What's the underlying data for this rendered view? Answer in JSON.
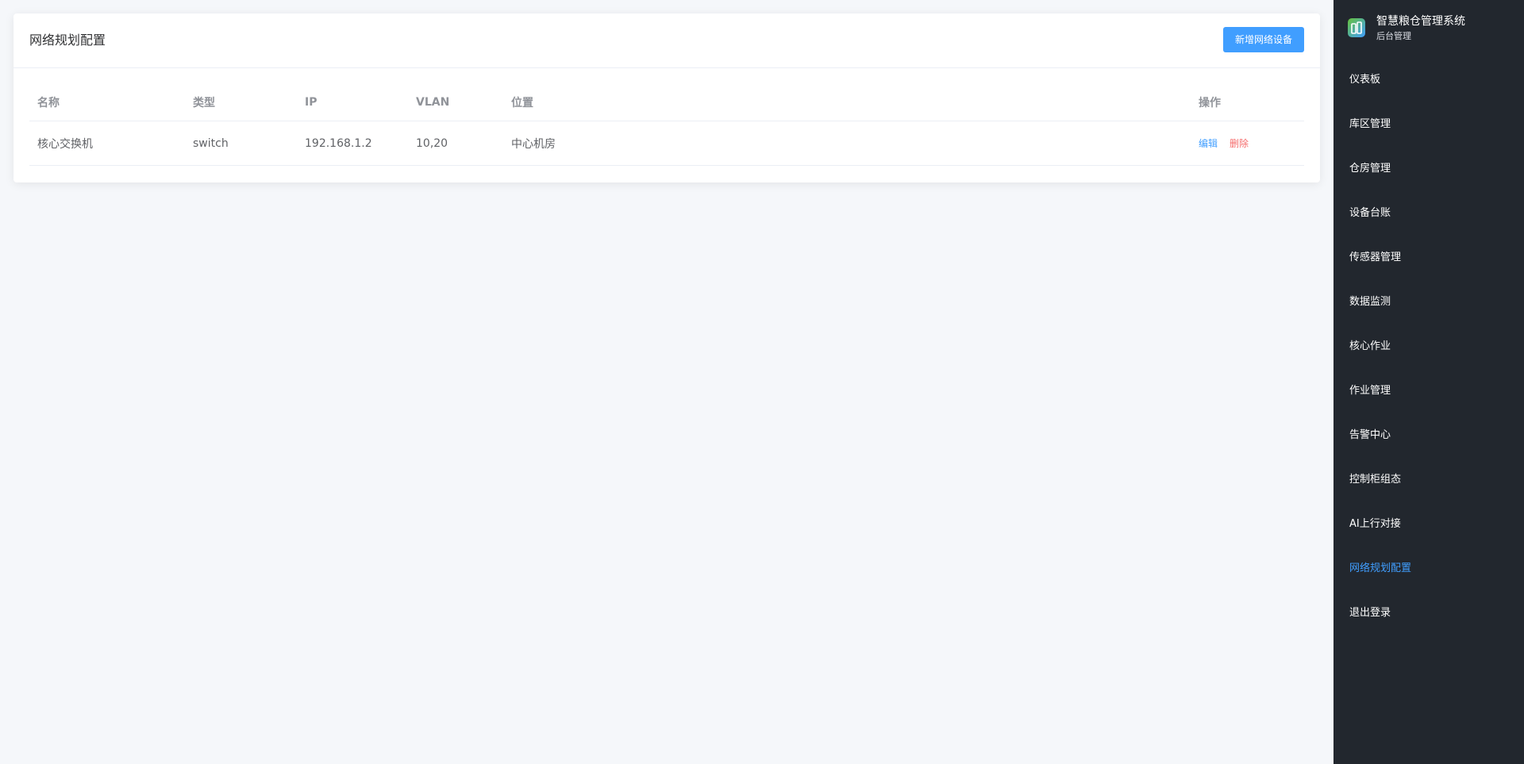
{
  "page": {
    "title": "网络规划配置",
    "add_button_label": "新增网络设备"
  },
  "table": {
    "headers": {
      "name": "名称",
      "type": "类型",
      "ip": "IP",
      "vlan": "VLAN",
      "location": "位置",
      "actions": "操作"
    },
    "rows": [
      {
        "name": "核心交换机",
        "type": "switch",
        "ip": "192.168.1.2",
        "vlan": "10,20",
        "location": "中心机房",
        "edit_label": "编辑",
        "delete_label": "删除"
      }
    ]
  },
  "sidebar": {
    "brand_name": "智慧粮仓管理系统",
    "brand_sub": "后台管理",
    "logo_icon": "granary-logo-icon",
    "items": [
      {
        "label": "仪表板"
      },
      {
        "label": "库区管理"
      },
      {
        "label": "仓房管理"
      },
      {
        "label": "设备台账"
      },
      {
        "label": "传感器管理"
      },
      {
        "label": "数据监测"
      },
      {
        "label": "核心作业"
      },
      {
        "label": "作业管理"
      },
      {
        "label": "告警中心"
      },
      {
        "label": "控制柜组态"
      },
      {
        "label": "AI上行对接"
      },
      {
        "label": "网络规划配置"
      },
      {
        "label": "退出登录"
      }
    ],
    "active_index": 11
  },
  "colors": {
    "accent": "#409eff",
    "danger": "#f56c6c",
    "sidebar_bg": "#22272e",
    "page_bg": "#f5f7fa"
  }
}
